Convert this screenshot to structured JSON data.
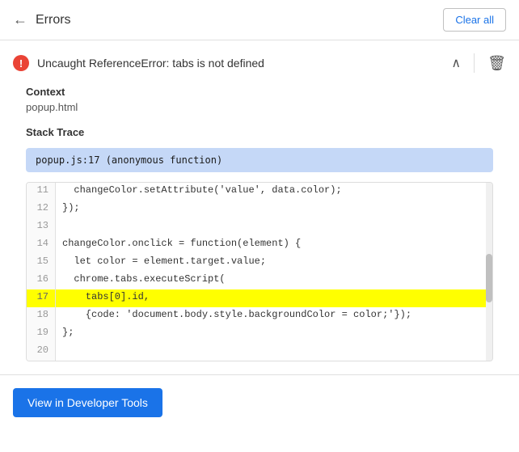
{
  "header": {
    "title": "Errors",
    "back_label": "←",
    "clear_all_label": "Clear all"
  },
  "error": {
    "message": "Uncaught ReferenceError: tabs is not defined",
    "context_label": "Context",
    "context_value": "popup.html",
    "stack_trace_label": "Stack Trace",
    "stack_trace_value": "popup.js:17 (anonymous function)"
  },
  "code": {
    "lines": [
      {
        "number": "11",
        "text": "  changeColor.setAttribute('value', data.color);",
        "highlighted": false
      },
      {
        "number": "12",
        "text": "});",
        "highlighted": false
      },
      {
        "number": "13",
        "text": "",
        "highlighted": false
      },
      {
        "number": "14",
        "text": "changeColor.onclick = function(element) {",
        "highlighted": false
      },
      {
        "number": "15",
        "text": "  let color = element.target.value;",
        "highlighted": false
      },
      {
        "number": "16",
        "text": "  chrome.tabs.executeScript(",
        "highlighted": false
      },
      {
        "number": "17",
        "text": "    tabs[0].id,",
        "highlighted": true
      },
      {
        "number": "18",
        "text": "    {code: 'document.body.style.backgroundColor = color;'});",
        "highlighted": false
      },
      {
        "number": "19",
        "text": "};",
        "highlighted": false
      },
      {
        "number": "20",
        "text": "",
        "highlighted": false
      }
    ]
  },
  "footer": {
    "dev_tools_label": "View in Developer Tools"
  }
}
